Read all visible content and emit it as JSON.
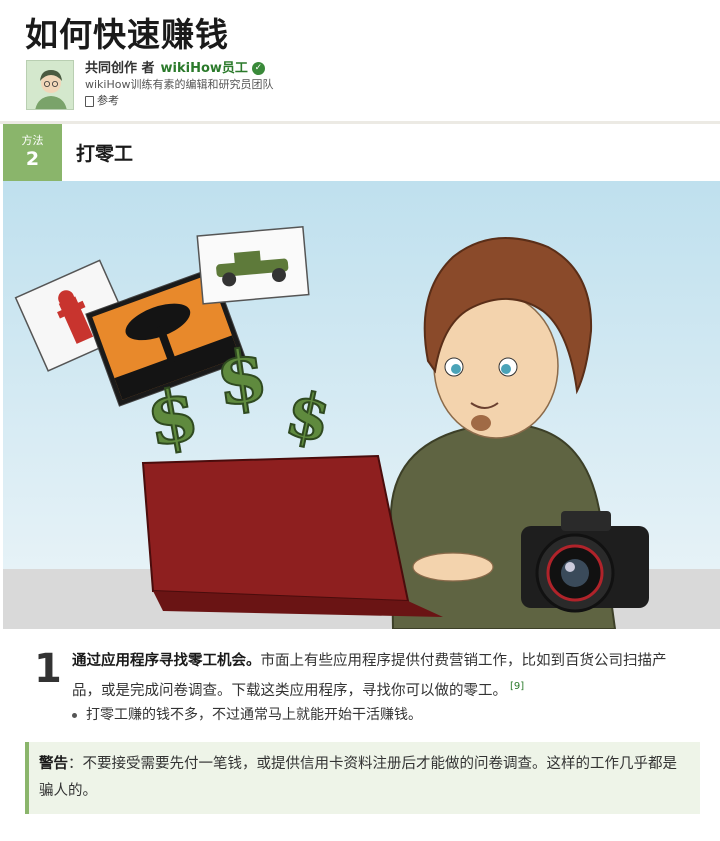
{
  "article": {
    "title": "如何快速赚钱"
  },
  "author": {
    "prefix": "共同创作 者",
    "staff_name": "wikiHow员工",
    "team": "wikiHow训练有素的编辑和研究员团队",
    "references": "参考"
  },
  "method": {
    "label": "方法",
    "number": "2",
    "title": "打零工"
  },
  "step": {
    "number": "1",
    "bold": "通过应用程序寻找零工机会。",
    "text": "市面上有些应用程序提供付费营销工作，比如到百货公司扫描产品，或是完成问卷调查。下载这类应用程序，寻找你可以做的零工。",
    "ref": "[9]"
  },
  "bullet": "打零工赚的钱不多，不过通常马上就能开始干活赚钱。",
  "warning": {
    "label": "警告",
    "text": "：不要接受需要先付一笔钱，或提供信用卡资料注册后才能做的问卷调查。这样的工作几乎都是骗人的。"
  },
  "illustration": {
    "symbols": [
      "$",
      "$",
      "$"
    ]
  },
  "colors": {
    "accent": "#8ab56b",
    "link": "#2b7a2b",
    "warning_bg": "#eef4e8"
  }
}
